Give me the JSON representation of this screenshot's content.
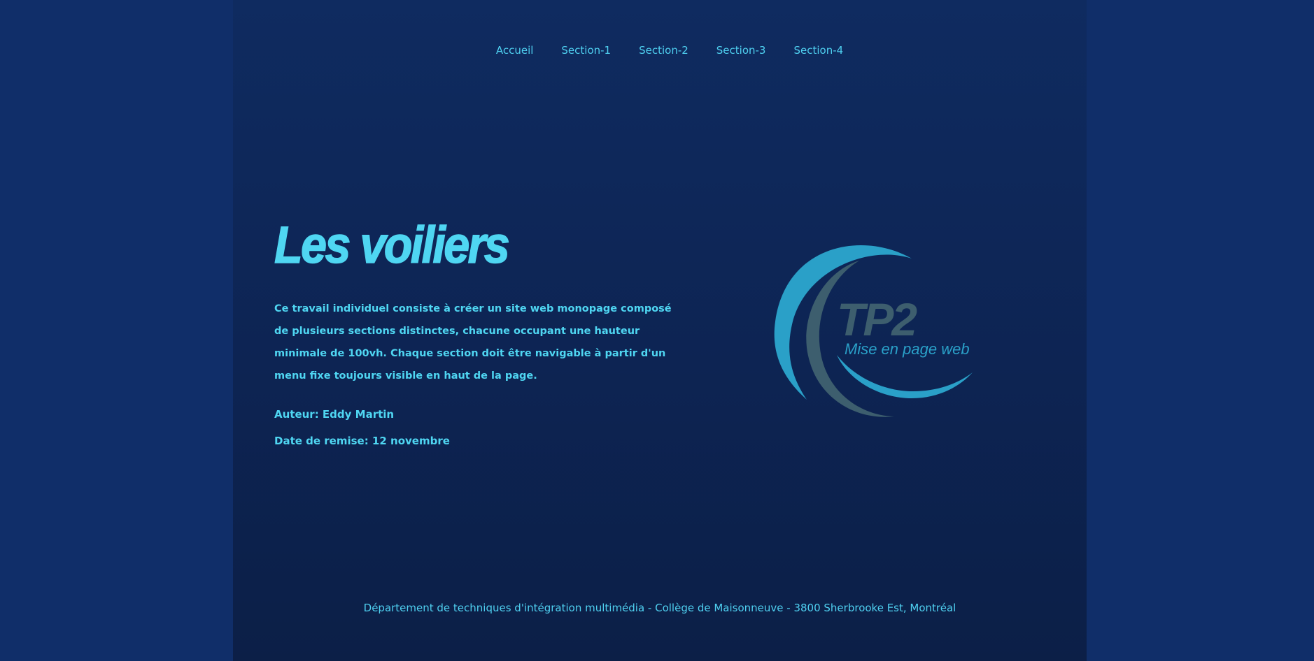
{
  "nav": {
    "items": [
      "Accueil",
      "Section-1",
      "Section-2",
      "Section-3",
      "Section-4"
    ]
  },
  "hero": {
    "title": "Les voiliers",
    "description": "Ce travail individuel consiste à créer un site web monopage composé de plusieurs sections distinctes, chacune occupant une hauteur minimale de 100vh. Chaque section doit être navigable à partir d'un menu fixe toujours visible en haut de la page.",
    "author": "Auteur: Eddy Martin",
    "due_date": "Date de remise: 12 novembre"
  },
  "logo": {
    "title": "TP2",
    "subtitle": "Mise en page web",
    "colors": {
      "arc_blue": "#2aa0c8",
      "arc_gray": "#3d5e6e",
      "text_gray": "#3d5e6e"
    }
  },
  "footer": {
    "text": "Département de techniques d'intégration multimédia - Collège de Maisonneuve - 3800 Sherbrooke Est, Montréal"
  },
  "colors": {
    "outer_background": "#102e69",
    "panel_background": "#0e2858",
    "accent_text": "#4fd6f2"
  }
}
